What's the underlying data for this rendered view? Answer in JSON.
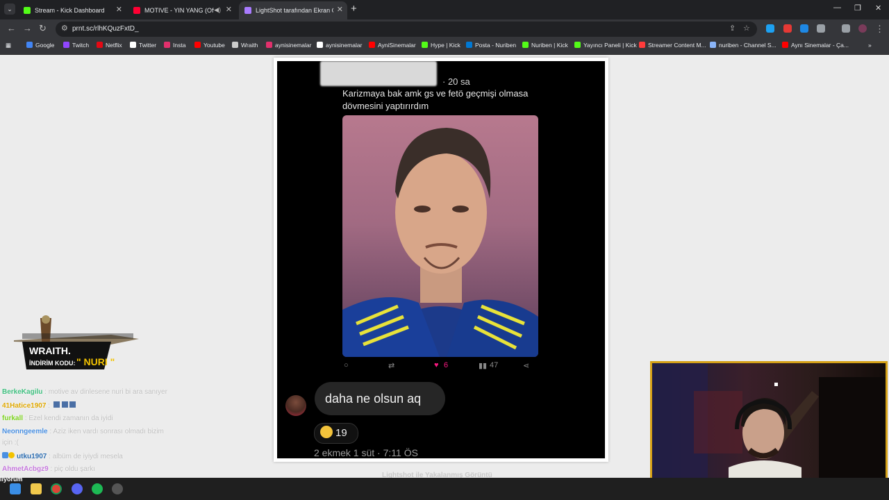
{
  "browser": {
    "tabs": [
      {
        "title": "Stream - Kick Dashboard",
        "icon": "kick-icon",
        "color": "#53fc18"
      },
      {
        "title": "MOTIVE - YIN YANG (Officia",
        "icon": "youtube-icon",
        "color": "#ff0033"
      },
      {
        "title": "LightShot tarafından Ekran Gör",
        "icon": "lightshot-icon",
        "color": "#a97bff"
      }
    ],
    "url": "prnt.sc/rlhKQuzFxtD_",
    "bookmarks": [
      {
        "label": "Google",
        "color": "#4285f4"
      },
      {
        "label": "Twitch",
        "color": "#9146ff"
      },
      {
        "label": "Netflix",
        "color": "#e50914"
      },
      {
        "label": "Twitter",
        "color": "#ffffff"
      },
      {
        "label": "Insta",
        "color": "#e1306c"
      },
      {
        "label": "Youtube",
        "color": "#ff0000"
      },
      {
        "label": "Wraith",
        "color": "#cccccc"
      },
      {
        "label": "aynisinemalar",
        "color": "#e1306c"
      },
      {
        "label": "aynisinemalar",
        "color": "#ffffff"
      },
      {
        "label": "AyniSinemalar",
        "color": "#ff0000"
      },
      {
        "label": "Hype | Kick",
        "color": "#53fc18"
      },
      {
        "label": "Posta - Nuriben",
        "color": "#0078d4"
      },
      {
        "label": "Nuriben | Kick",
        "color": "#53fc18"
      },
      {
        "label": "Yayıncı Paneli | Kick",
        "color": "#53fc18"
      },
      {
        "label": "Streamer Content M...",
        "color": "#ff3b3b"
      },
      {
        "label": "nuriben - Channel S...",
        "color": "#8ab4f8"
      },
      {
        "label": "Aynı Sinemalar - Ça...",
        "color": "#ff0000"
      }
    ]
  },
  "tweet": {
    "time": "· 20 sa",
    "text": "Karizmaya bak amk gs ve fetö geçmişi olmasa dövmesini yaptırırdım",
    "likes": "6",
    "views": "47",
    "reply_text": "daha ne olsun aq",
    "reaction_count": "19",
    "reply_meta": "2 ekmek 1 süt · 7:11 ÖS"
  },
  "page_caption": "Lightshot ile Yakalanmış Görüntü",
  "overlay": {
    "brand": "WRAITH.",
    "promo_label": "İNDİRİM KODU:",
    "promo_code": "\" NURI \""
  },
  "chat": [
    {
      "user": "BerkeKagilu",
      "msg": ": motive av dinlesene nuri bi ara sanıyer",
      "color": "#3fbf7f"
    },
    {
      "user": "41Hatice1907",
      "msg": ":",
      "color": "#e0a800"
    },
    {
      "user": "furkall",
      "msg": ": Ezel kendi zamanın da iyidi",
      "color": "#7ed321"
    },
    {
      "user": "Neonngeemle",
      "msg": ": Aziz iken vardı sonrası olmadı bizim",
      "color": "#4a90e2"
    },
    {
      "user": "",
      "msg": "için :(",
      "color": "#bfbfbf"
    },
    {
      "user": "utku1907",
      "msg": ": albüm de iyiydi mesela",
      "color": "#2b6cb0"
    },
    {
      "user": "AhmetAcbgz9",
      "msg": ": piç oldu şarkı",
      "color": "#c678dd"
    }
  ],
  "taskbar_label": "liyorum"
}
